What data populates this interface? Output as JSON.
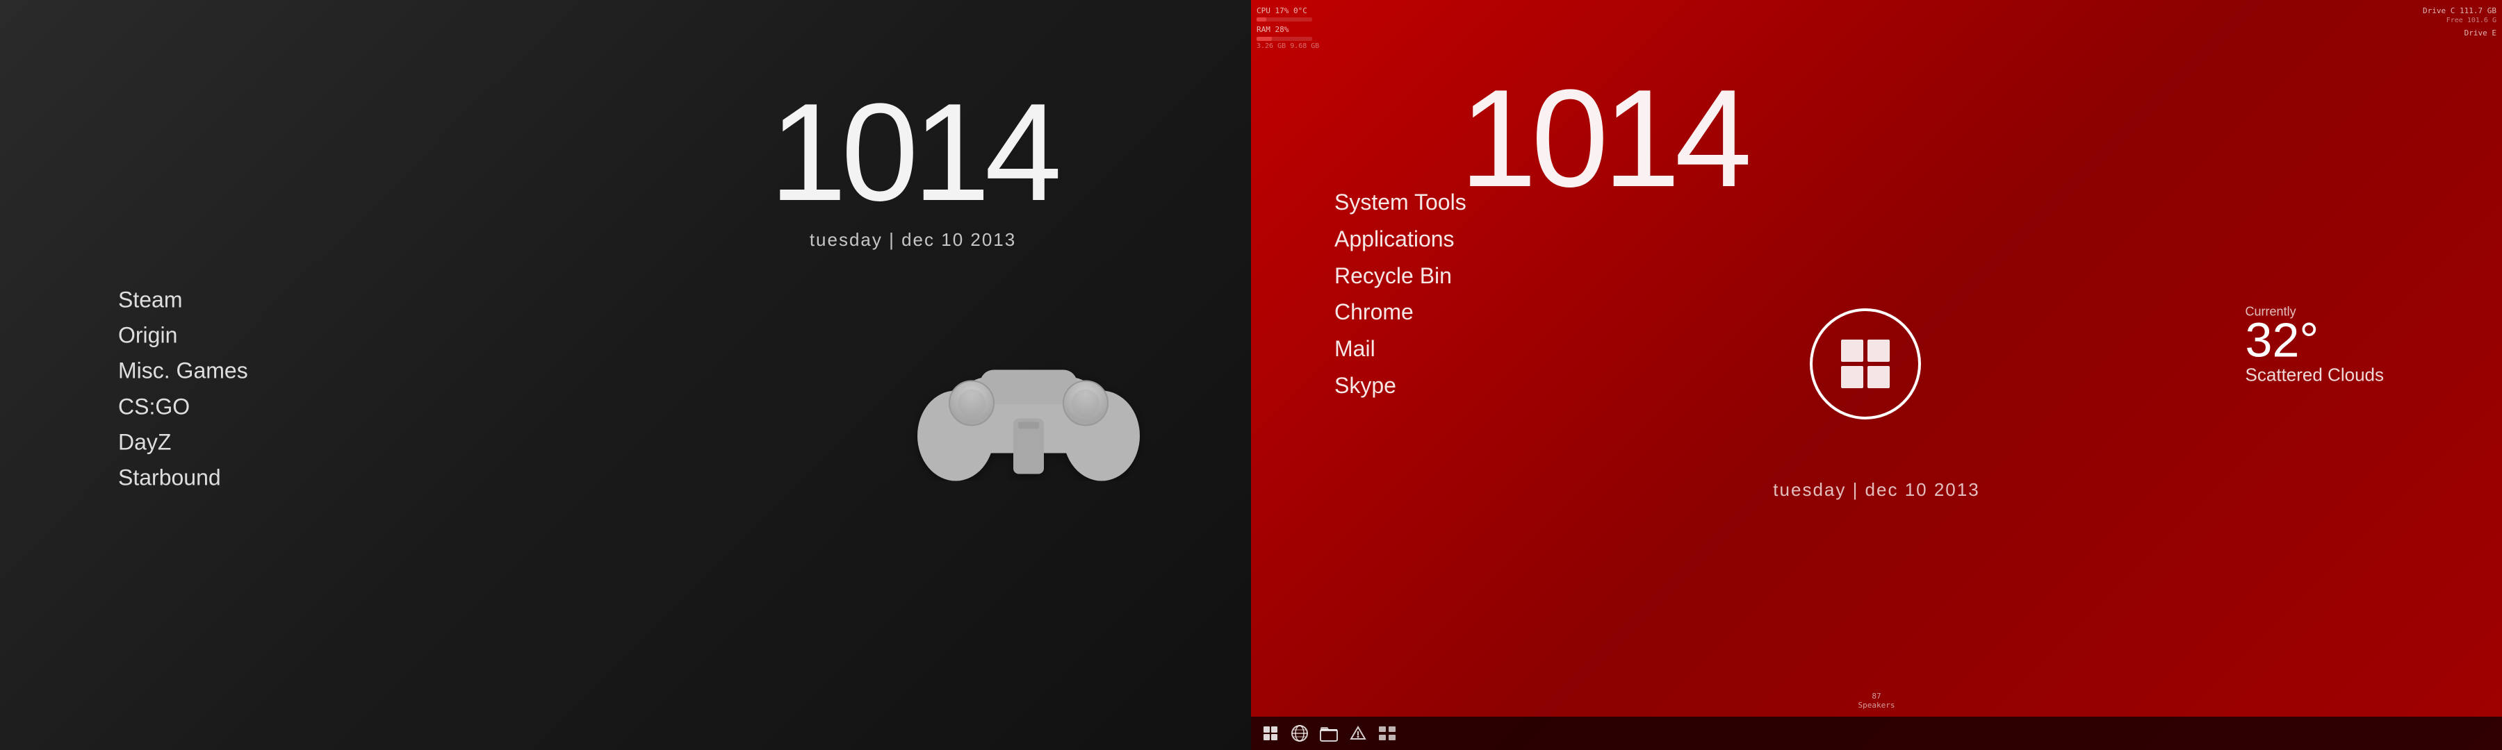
{
  "left": {
    "clock": {
      "time": "1014",
      "date": "tuesday | dec 10 2013"
    },
    "nav": {
      "items": [
        {
          "label": "Steam",
          "id": "steam"
        },
        {
          "label": "Origin",
          "id": "origin"
        },
        {
          "label": "Misc. Games",
          "id": "misc-games"
        },
        {
          "label": "CS:GO",
          "id": "csgo"
        },
        {
          "label": "DayZ",
          "id": "dayz"
        },
        {
          "label": "Starbound",
          "id": "starbound"
        }
      ]
    }
  },
  "right": {
    "clock": {
      "time": "1014",
      "date": "tuesday | dec 10 2013"
    },
    "nav": {
      "items": [
        {
          "label": "System Tools",
          "id": "system-tools"
        },
        {
          "label": "Applications",
          "id": "applications"
        },
        {
          "label": "Recycle Bin",
          "id": "recycle-bin"
        },
        {
          "label": "Chrome",
          "id": "chrome"
        },
        {
          "label": "Mail",
          "id": "mail"
        },
        {
          "label": "Skype",
          "id": "skype"
        }
      ]
    },
    "weather": {
      "currently_label": "Currently",
      "temperature": "32°",
      "description": "Scattered Clouds"
    },
    "sysmon": {
      "cpu_label": "CPU",
      "cpu_value": "17%",
      "cpu_temp": "0°C",
      "cpu_bar_pct": 17,
      "ram_label": "RAM",
      "ram_value": "28%",
      "ram_bar_pct": 28,
      "ram_used": "3.26 GB",
      "ram_total": "9.68 GB",
      "drive_c_label": "Drive C",
      "drive_c_free": "Free",
      "drive_c_size": "111.7 GB",
      "drive_c_val": "101.6 G",
      "drive_e_label": "Drive E",
      "drive_e_val": "..."
    },
    "speaker": "87\nSpeakers"
  }
}
